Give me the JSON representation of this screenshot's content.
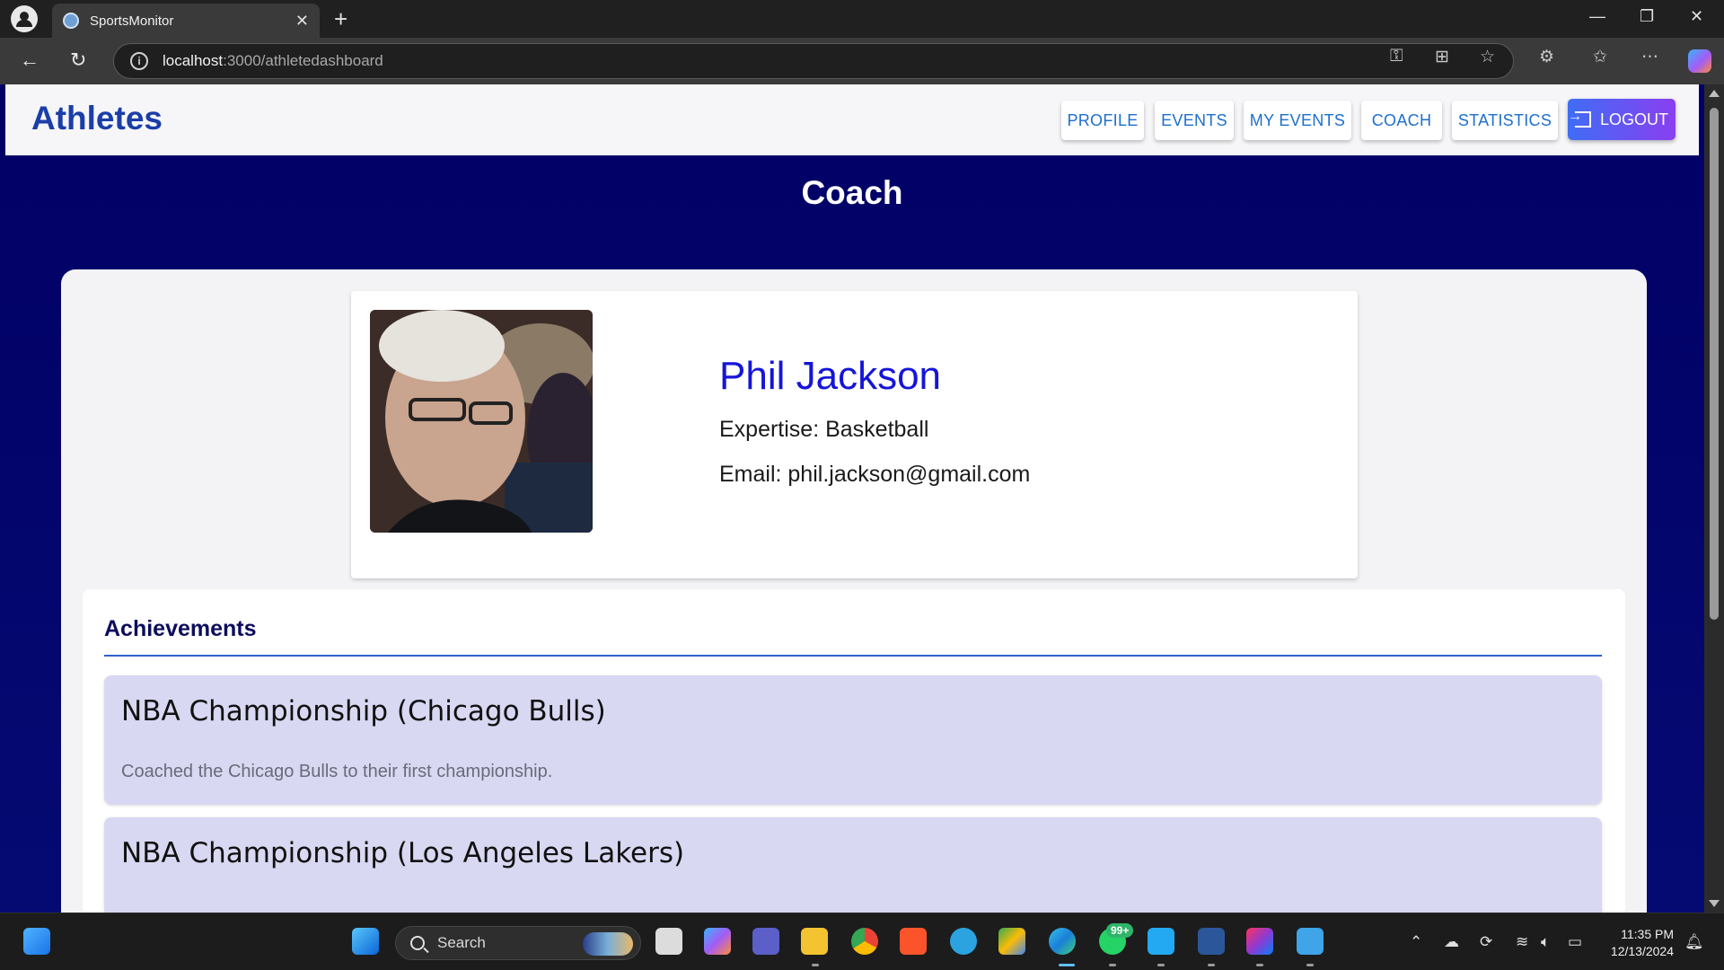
{
  "browser": {
    "tab_title": "SportsMonitor",
    "url_host": "localhost",
    "url_path": ":3000/athletedashboard"
  },
  "header": {
    "brand": "Athletes",
    "nav": [
      {
        "label": "PROFILE"
      },
      {
        "label": "EVENTS"
      },
      {
        "label": "MY EVENTS"
      },
      {
        "label": "COACH"
      },
      {
        "label": "STATISTICS"
      }
    ],
    "logout_label": "LOGOUT"
  },
  "page": {
    "title": "Coach"
  },
  "coach": {
    "name": "Phil Jackson",
    "expertise": "Expertise: Basketball",
    "email": "Email: phil.jackson@gmail.com"
  },
  "achievements": {
    "heading": "Achievements",
    "items": [
      {
        "title": "NBA Championship (Chicago Bulls)",
        "description": "Coached the Chicago Bulls to their first championship."
      },
      {
        "title": "NBA Championship (Los Angeles Lakers)",
        "description": ""
      }
    ]
  },
  "taskbar": {
    "search_label": "Search",
    "whatsapp_badge": "99+",
    "time": "11:35 PM",
    "date": "12/13/2024"
  },
  "colors": {
    "brand": "#1b3ea8",
    "page_bg": "#020066",
    "coach_name": "#1515d8",
    "achievement_bg": "#d8d8f2"
  }
}
